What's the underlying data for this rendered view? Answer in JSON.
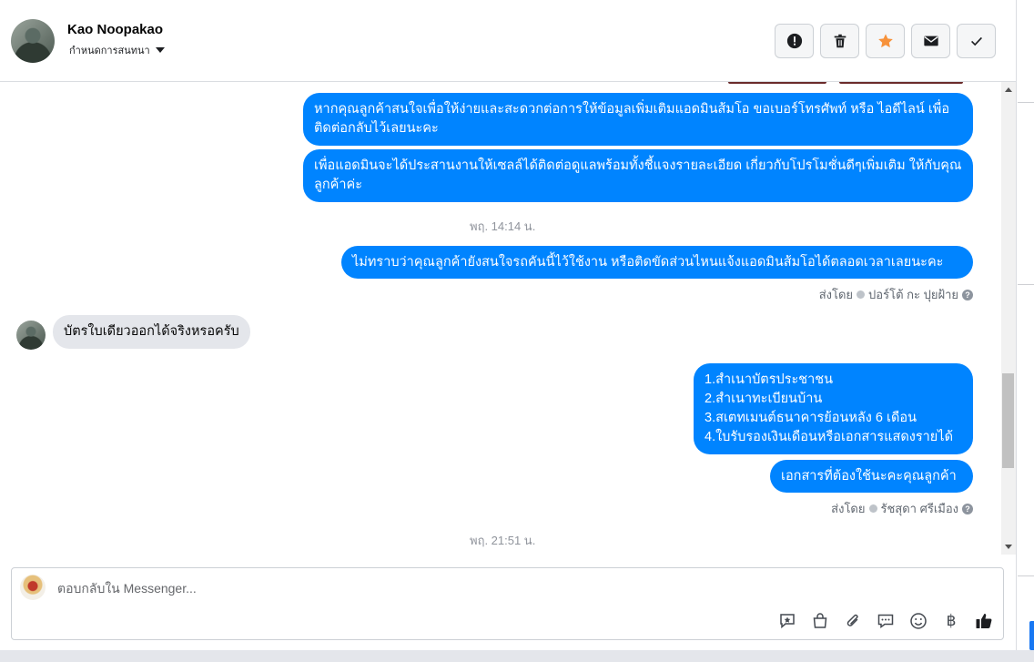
{
  "header": {
    "contact_name": "Kao Noopakao",
    "status_label": "กำหนดการสนทนา",
    "actions": [
      {
        "name": "report-button",
        "icon": "alert-icon"
      },
      {
        "name": "delete-button",
        "icon": "trash-icon"
      },
      {
        "name": "star-button",
        "icon": "star-icon"
      },
      {
        "name": "mark-unread-button",
        "icon": "envelope-icon"
      },
      {
        "name": "mark-done-button",
        "icon": "check-icon"
      }
    ],
    "star_color": "#f7923b"
  },
  "thread": {
    "messages": [
      {
        "text": "หากคุณลูกค้าสนใจเพื่อให้ง่ายและสะดวกต่อการให้ข้อมูลเพิ่มเติมแอดมินส้มโอ ขอเบอร์โทรศัพท์ หรือ ไอดีไลน์ เพื่อติดต่อกลับไว้เลยนะคะ"
      },
      {
        "text": "เพื่อแอดมินจะได้ประสานงานให้เซลล์ได้ติดต่อดูแลพร้อมทั้งชี้แจงรายละเอียด เกี่ยวกับโปรโมชั่นดีๆเพิ่มเติม ให้กับคุณลูกค้าค่ะ"
      },
      {
        "text": "ไม่ทราบว่าคุณลูกค้ายังสนใจรถคันนี้ไว้ใช้งาน หรือติดขัดส่วนไหนแจ้งแอดมินส้มโอได้ตลอดเวลาเลยนะคะ"
      },
      {
        "text": "บัตรใบเดียวออกได้จริงหรอครับ"
      },
      {
        "lines": [
          "1.สำเนาบัตรประชาชน",
          "2.สำเนาทะเบียนบ้าน",
          "3.สเตทเมนต์ธนาคารย้อนหลัง 6 เดือน",
          "4.ใบรับรองเงินเดือนหรือเอกสารแสดงรายได้"
        ]
      },
      {
        "text": "เอกสารที่ต้องใช้นะคะคุณลูกค้า"
      }
    ],
    "timestamps": [
      "พฤ. 14:14 น.",
      "พฤ. 21:51 น."
    ],
    "sent_by": [
      {
        "prefix": "ส่งโดย",
        "name": "ปอร์โต้ กะ ปุยฝ้าย"
      },
      {
        "prefix": "ส่งโดย",
        "name": "รัชสุดา ศรีเมือง"
      }
    ],
    "help_glyph": "?",
    "outgoing_color": "#0084ff",
    "incoming_color": "#e4e6eb"
  },
  "composer": {
    "placeholder": "ตอบกลับใน Messenger...",
    "tools": [
      {
        "name": "saved-reply-button",
        "icon": "chat-star-icon"
      },
      {
        "name": "shop-button",
        "icon": "shopping-bag-icon"
      },
      {
        "name": "attach-button",
        "icon": "paperclip-icon"
      },
      {
        "name": "quick-reply-button",
        "icon": "chat-bubbles-icon"
      },
      {
        "name": "emoji-button",
        "icon": "smiley-icon"
      },
      {
        "name": "payment-button",
        "icon": "baht-icon",
        "glyph": "฿"
      },
      {
        "name": "like-button",
        "icon": "thumbs-up-icon"
      }
    ]
  }
}
